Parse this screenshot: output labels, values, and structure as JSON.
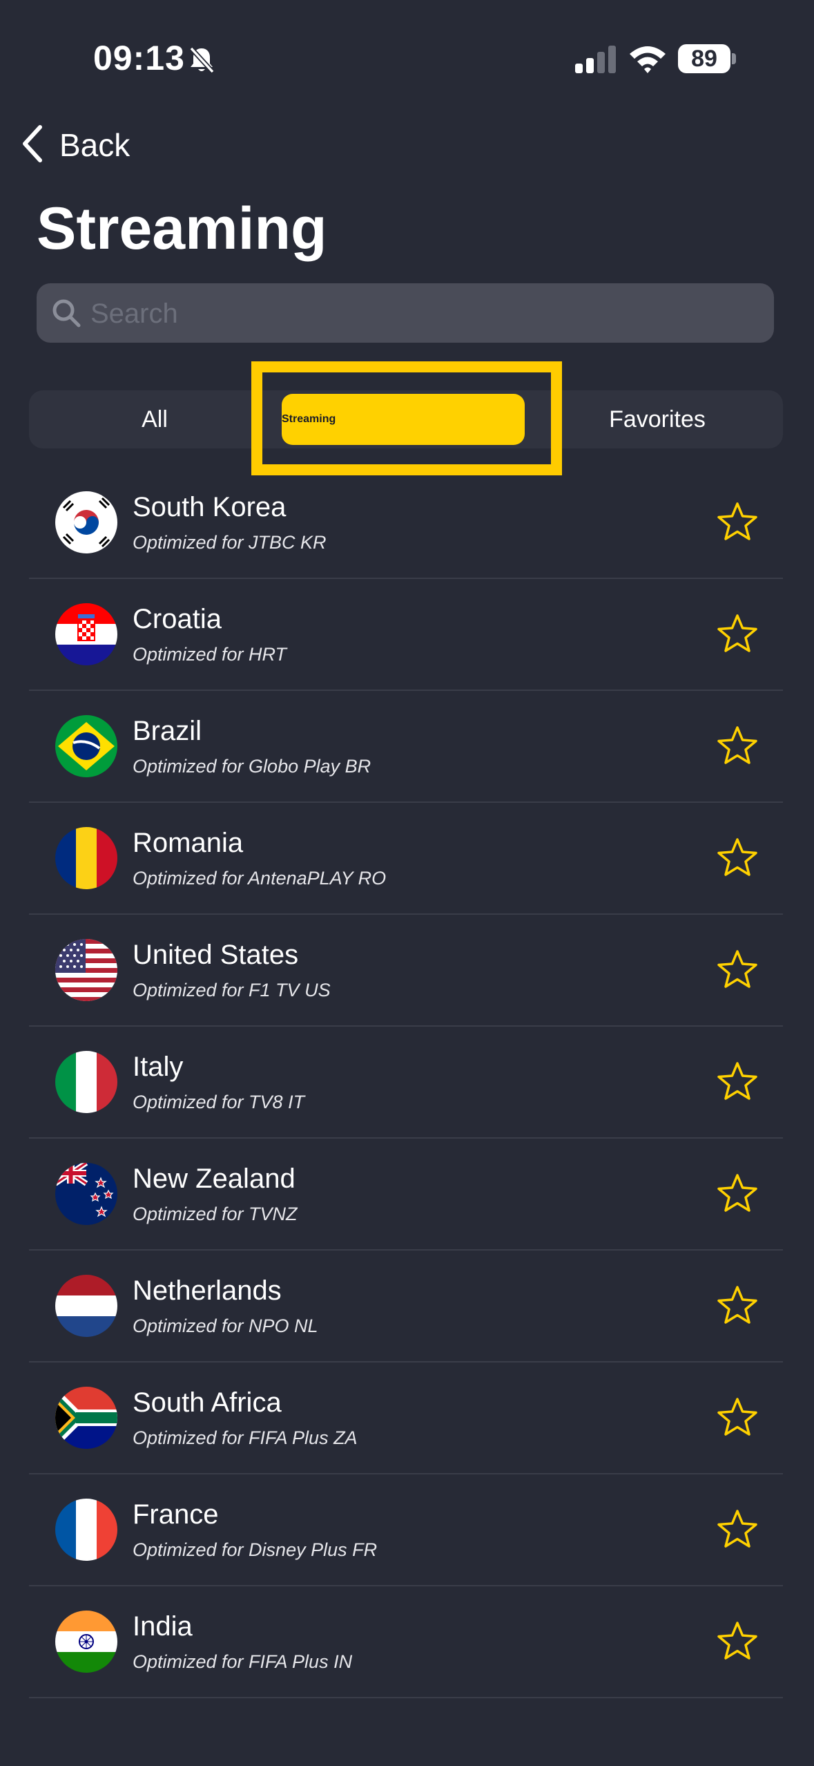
{
  "status": {
    "time": "09:13",
    "battery": "89"
  },
  "nav": {
    "back_label": "Back"
  },
  "page": {
    "title": "Streaming"
  },
  "search": {
    "placeholder": "Search"
  },
  "tabs": [
    {
      "label": "All",
      "selected": false
    },
    {
      "label": "Streaming",
      "selected": true
    },
    {
      "label": "Favorites",
      "selected": false
    }
  ],
  "colors": {
    "accent": "#ffd100",
    "background": "#272a36",
    "highlight_box": "#ffcc00"
  },
  "servers": [
    {
      "country": "South Korea",
      "subtitle": "Optimized for JTBC KR",
      "flag": "kr-flag-icon"
    },
    {
      "country": "Croatia",
      "subtitle": "Optimized for HRT",
      "flag": "hr-flag-icon"
    },
    {
      "country": "Brazil",
      "subtitle": "Optimized for Globo Play BR",
      "flag": "br-flag-icon"
    },
    {
      "country": "Romania",
      "subtitle": "Optimized for AntenaPLAY RO",
      "flag": "ro-flag-icon"
    },
    {
      "country": "United States",
      "subtitle": "Optimized for F1 TV US",
      "flag": "us-flag-icon"
    },
    {
      "country": "Italy",
      "subtitle": "Optimized for TV8 IT",
      "flag": "it-flag-icon"
    },
    {
      "country": "New Zealand",
      "subtitle": "Optimized for TVNZ",
      "flag": "nz-flag-icon"
    },
    {
      "country": "Netherlands",
      "subtitle": "Optimized for NPO NL",
      "flag": "nl-flag-icon"
    },
    {
      "country": "South Africa",
      "subtitle": "Optimized for FIFA Plus ZA",
      "flag": "za-flag-icon"
    },
    {
      "country": "France",
      "subtitle": "Optimized for Disney Plus FR",
      "flag": "fr-flag-icon"
    },
    {
      "country": "India",
      "subtitle": "Optimized for FIFA Plus IN",
      "flag": "in-flag-icon"
    }
  ]
}
